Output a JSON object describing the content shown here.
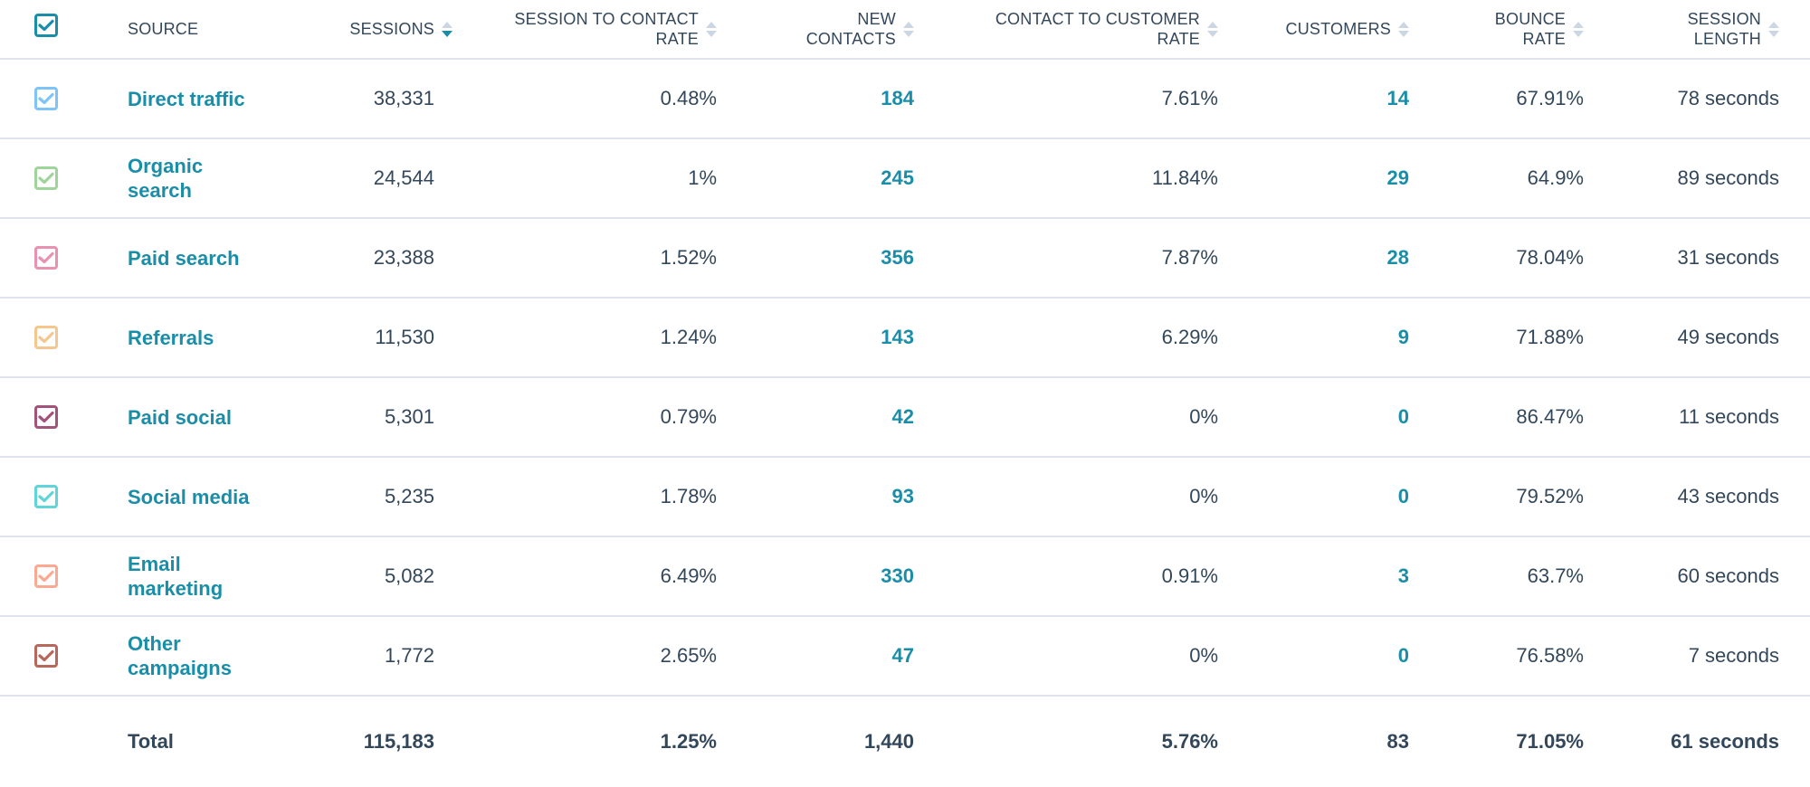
{
  "header": {
    "select_all_checked": true,
    "select_all_color": "#1a8ea8",
    "columns": [
      {
        "key": "source",
        "label": "SOURCE",
        "sortable": false
      },
      {
        "key": "sessions",
        "label": "SESSIONS",
        "sortable": true,
        "sort": "desc"
      },
      {
        "key": "s2c_rate",
        "label_line1": "SESSION TO CONTACT",
        "label_line2": "RATE",
        "sortable": true,
        "sort": "none"
      },
      {
        "key": "new_contacts",
        "label_line1": "NEW",
        "label_line2": "CONTACTS",
        "sortable": true,
        "sort": "none"
      },
      {
        "key": "c2c_rate",
        "label_line1": "CONTACT TO CUSTOMER",
        "label_line2": "RATE",
        "sortable": true,
        "sort": "none"
      },
      {
        "key": "customers",
        "label": "CUSTOMERS",
        "sortable": true,
        "sort": "none"
      },
      {
        "key": "bounce_rate",
        "label_line1": "BOUNCE",
        "label_line2": "RATE",
        "sortable": true,
        "sort": "none"
      },
      {
        "key": "session_length",
        "label_line1": "SESSION",
        "label_line2": "LENGTH",
        "sortable": true,
        "sort": "none"
      }
    ]
  },
  "rows": [
    {
      "source_line1": "Direct traffic",
      "source_line2": "",
      "color": "#7fc4f8",
      "checked": true,
      "sessions": "38,331",
      "s2c_rate": "0.48%",
      "new_contacts": "184",
      "c2c_rate": "7.61%",
      "customers": "14",
      "bounce_rate": "67.91%",
      "session_length": "78 seconds"
    },
    {
      "source_line1": "Organic",
      "source_line2": "search",
      "color": "#9fd49a",
      "checked": true,
      "sessions": "24,544",
      "s2c_rate": "1%",
      "new_contacts": "245",
      "c2c_rate": "11.84%",
      "customers": "29",
      "bounce_rate": "64.9%",
      "session_length": "89 seconds"
    },
    {
      "source_line1": "Paid search",
      "source_line2": "",
      "color": "#ea90b1",
      "checked": true,
      "sessions": "23,388",
      "s2c_rate": "1.52%",
      "new_contacts": "356",
      "c2c_rate": "7.87%",
      "customers": "28",
      "bounce_rate": "78.04%",
      "session_length": "31 seconds"
    },
    {
      "source_line1": "Referrals",
      "source_line2": "",
      "color": "#f5c78e",
      "checked": true,
      "sessions": "11,530",
      "s2c_rate": "1.24%",
      "new_contacts": "143",
      "c2c_rate": "6.29%",
      "customers": "9",
      "bounce_rate": "71.88%",
      "session_length": "49 seconds"
    },
    {
      "source_line1": "Paid social",
      "source_line2": "",
      "color": "#a2537a",
      "checked": true,
      "sessions": "5,301",
      "s2c_rate": "0.79%",
      "new_contacts": "42",
      "c2c_rate": "0%",
      "customers": "0",
      "bounce_rate": "86.47%",
      "session_length": "11 seconds"
    },
    {
      "source_line1": "Social media",
      "source_line2": "",
      "color": "#5fd4d9",
      "checked": true,
      "sessions": "5,235",
      "s2c_rate": "1.78%",
      "new_contacts": "93",
      "c2c_rate": "0%",
      "customers": "0",
      "bounce_rate": "79.52%",
      "session_length": "43 seconds"
    },
    {
      "source_line1": "Email",
      "source_line2": "marketing",
      "color": "#fda891",
      "checked": true,
      "sessions": "5,082",
      "s2c_rate": "6.49%",
      "new_contacts": "330",
      "c2c_rate": "0.91%",
      "customers": "3",
      "bounce_rate": "63.7%",
      "session_length": "60 seconds"
    },
    {
      "source_line1": "Other",
      "source_line2": "campaigns",
      "color": "#b9675a",
      "checked": true,
      "sessions": "1,772",
      "s2c_rate": "2.65%",
      "new_contacts": "47",
      "c2c_rate": "0%",
      "customers": "0",
      "bounce_rate": "76.58%",
      "session_length": "7 seconds"
    }
  ],
  "total": {
    "label": "Total",
    "sessions": "115,183",
    "s2c_rate": "1.25%",
    "new_contacts": "1,440",
    "c2c_rate": "5.76%",
    "customers": "83",
    "bounce_rate": "71.05%",
    "session_length": "61 seconds"
  },
  "colors": {
    "text": "#33475b",
    "link": "#1a8ea8",
    "divider": "#dfe3eb",
    "sort_inactive": "#cbd6e2",
    "sort_active": "#1a8ea8"
  }
}
